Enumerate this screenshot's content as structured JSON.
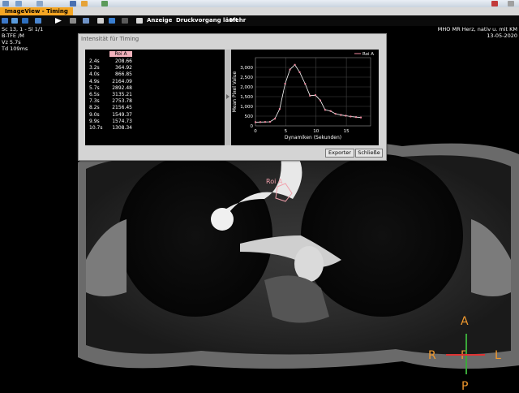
{
  "app": {
    "active_tab": "ImageView - Timing",
    "menus": [
      "Anzeige",
      "Druckvorgang läuft",
      "Mehr"
    ]
  },
  "overlay_left": {
    "line1": "Sc 13, 1 - Sl 1/1",
    "line2": "B-TFE   /M",
    "line3": "Vz  5.7s",
    "line4": "Td 109ms"
  },
  "overlay_right": {
    "line1": "MHO MR Herz, nativ u. mit KM",
    "line2": "13-05-2020"
  },
  "dialog": {
    "title": "Intensität für Timing",
    "table": {
      "column_header": "Roi A",
      "rows": [
        {
          "time": "2.4s",
          "value": "208.66"
        },
        {
          "time": "3.2s",
          "value": "364.92"
        },
        {
          "time": "4.0s",
          "value": "866.85"
        },
        {
          "time": "4.9s",
          "value": "2164.09"
        },
        {
          "time": "5.7s",
          "value": "2892.48"
        },
        {
          "time": "6.5s",
          "value": "3135.21"
        },
        {
          "time": "7.3s",
          "value": "2753.78"
        },
        {
          "time": "8.2s",
          "value": "2156.45"
        },
        {
          "time": "9.0s",
          "value": "1549.37"
        },
        {
          "time": "9.9s",
          "value": "1574.73"
        },
        {
          "time": "10.7s",
          "value": "1308.34"
        }
      ]
    },
    "buttons": {
      "export": "Exporter",
      "close": "Schließe"
    }
  },
  "chart_data": {
    "type": "line",
    "xlabel": "Dynamiken (Sekunden)",
    "ylabel": "Mean Pixel Value",
    "legend": "Roi A",
    "legend_position": "top-right",
    "xlim": [
      0,
      19
    ],
    "ylim": [
      0,
      3500
    ],
    "xticks": [
      0,
      5,
      10,
      15
    ],
    "yticks": [
      0,
      500,
      1000,
      1500,
      2000,
      2500,
      3000
    ],
    "ytick_labels": [
      "0",
      "500",
      "1,000",
      "1,500",
      "2,000",
      "2,500",
      "3,000"
    ],
    "grid": true,
    "series": [
      {
        "name": "Roi A",
        "color": "#ffffff",
        "marker_color": "#f08aa0",
        "x": [
          0.0,
          0.8,
          1.6,
          2.4,
          3.2,
          4.0,
          4.9,
          5.7,
          6.5,
          7.3,
          8.2,
          9.0,
          9.9,
          10.7,
          11.5,
          12.4,
          13.2,
          14.1,
          14.9,
          15.7,
          16.6,
          17.4
        ],
        "y": [
          190,
          195,
          200,
          208.66,
          364.92,
          866.85,
          2164.09,
          2892.48,
          3135.21,
          2753.78,
          2156.45,
          1549.37,
          1574.73,
          1308.34,
          820,
          760,
          620,
          560,
          520,
          480,
          450,
          430
        ]
      }
    ]
  },
  "image_annotation": {
    "roi_label": "Roi A"
  },
  "orientation": {
    "top": "A",
    "left": "R",
    "center": "F",
    "right": "L",
    "bottom": "P"
  },
  "colors": {
    "accent": "#f5a623",
    "roi": "#f2a0ac",
    "orientation": "#f29a2e"
  }
}
